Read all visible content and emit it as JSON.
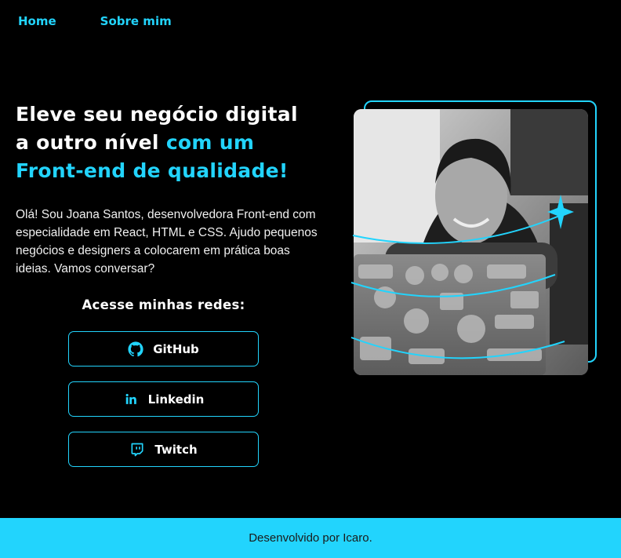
{
  "nav": {
    "items": [
      {
        "label": "Home"
      },
      {
        "label": "Sobre mim"
      }
    ]
  },
  "hero": {
    "title_line1": "Eleve seu negócio digital",
    "title_line2_plain": "a outro nível ",
    "title_line2_accent": "com um",
    "title_line3_accent": "Front-end de qualidade!",
    "intro": "Olá! Sou Joana Santos, desenvolvedora Front-end com especialidade em React, HTML e CSS. Ajudo pequenos negócios e designers a colocarem em prática boas ideias. Vamos conversar?"
  },
  "socials": {
    "title": "Acesse minhas redes:",
    "buttons": [
      {
        "label": "GitHub",
        "icon": "github-icon"
      },
      {
        "label": "Linkedin",
        "icon": "linkedin-icon"
      },
      {
        "label": "Twitch",
        "icon": "twitch-icon"
      }
    ]
  },
  "footer": {
    "text": "Desenvolvido por Icaro."
  },
  "colors": {
    "accent": "#22d4fd",
    "background": "#000000",
    "text": "#ffffff"
  }
}
